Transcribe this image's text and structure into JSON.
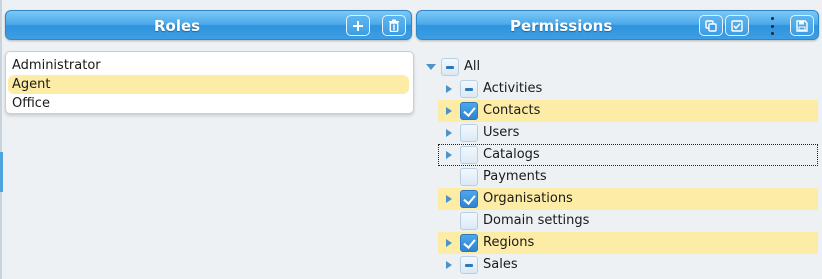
{
  "roles": {
    "title": "Roles",
    "add_icon": "plus-icon",
    "delete_icon": "trash-icon",
    "items": [
      {
        "label": "Administrator",
        "selected": false
      },
      {
        "label": "Agent",
        "selected": true
      },
      {
        "label": "Office",
        "selected": false
      }
    ]
  },
  "permissions": {
    "title": "Permissions",
    "toolbar_icons": [
      "copy-icon",
      "check-all-icon",
      "more-vert-icon",
      "save-icon"
    ],
    "tree": {
      "root": {
        "label": "All",
        "state": "partial",
        "expanded": true
      },
      "children": [
        {
          "label": "Activities",
          "state": "partial",
          "expandable": true,
          "highlighted": false
        },
        {
          "label": "Contacts",
          "state": "checked",
          "expandable": true,
          "highlighted": true
        },
        {
          "label": "Users",
          "state": "unchecked",
          "expandable": true,
          "highlighted": false
        },
        {
          "label": "Catalogs",
          "state": "unchecked",
          "expandable": true,
          "highlighted": false,
          "focused": true
        },
        {
          "label": "Payments",
          "state": "unchecked",
          "expandable": false,
          "highlighted": false
        },
        {
          "label": "Organisations",
          "state": "checked",
          "expandable": true,
          "highlighted": true
        },
        {
          "label": "Domain settings",
          "state": "unchecked",
          "expandable": false,
          "highlighted": false
        },
        {
          "label": "Regions",
          "state": "checked",
          "expandable": true,
          "highlighted": true
        },
        {
          "label": "Sales",
          "state": "partial",
          "expandable": true,
          "highlighted": false
        }
      ]
    }
  },
  "colors": {
    "header_blue": "#3c9fe4",
    "selection_yellow": "#fdeca6",
    "check_blue": "#2c84d4"
  }
}
